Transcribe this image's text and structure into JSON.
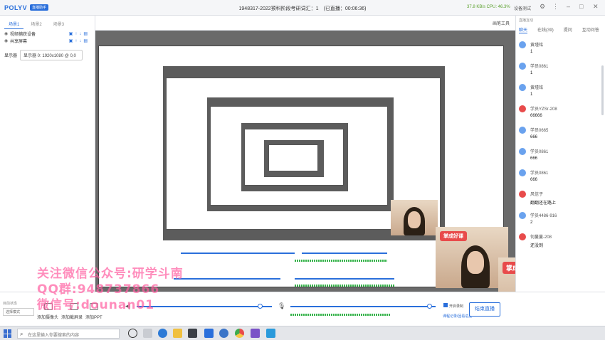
{
  "app": {
    "logo": "POLYV",
    "badge": "直播助手",
    "session_title": "1948317-2022预科阶段考研词汇：1　(已直播：00:06:36)",
    "sys_stats": "37.8 KB/s  CPU: 46.3%",
    "device_test": "设备测试"
  },
  "left": {
    "tabs": [
      "场景1",
      "场景2",
      "场景3"
    ],
    "sources": [
      "视频捕获设备",
      "共享屏幕"
    ],
    "display_label": "显示器",
    "display_value": "显示器 0: 1920x1080 @ 0,0"
  },
  "stage": {
    "whiteboard": "画笔工具"
  },
  "watermark": {
    "line1": "关注微信公众号:研学斗南",
    "line2": "QQ群:948737866",
    "line3": "微信号:dounan01"
  },
  "chat": {
    "title": "直播互动",
    "tabs": [
      "聊天",
      "在线(39)",
      "提问",
      "互动问答"
    ],
    "messages": [
      {
        "name": "黄瑾铭",
        "text": "1"
      },
      {
        "name": "学员0861",
        "text": "1"
      },
      {
        "name": "黄瑾铭",
        "text": "1"
      },
      {
        "name": "学员YZSr-208",
        "text": "66666"
      },
      {
        "name": "学员0665",
        "text": "666"
      },
      {
        "name": "学员0861",
        "text": "666"
      },
      {
        "name": "学员0861",
        "text": "666"
      },
      {
        "name": "风信子",
        "text": "翻翻还在路上"
      },
      {
        "name": "学员4486-916",
        "text": "2"
      },
      {
        "name": "何蔓蔓-208",
        "text": "还没到"
      }
    ]
  },
  "bottom": {
    "status_label": "目前状态",
    "status_value": "选择模式",
    "tools": [
      "添加摄像头",
      "添加截屏录",
      "添加PPT"
    ],
    "checkbox": "开启录制",
    "link": "课程记录/回看进度",
    "end_button": "结束直播"
  },
  "taskbar": {
    "search_placeholder": "在这里输入你要搜索的内容"
  },
  "cam": {
    "brand": "掌成好课"
  }
}
